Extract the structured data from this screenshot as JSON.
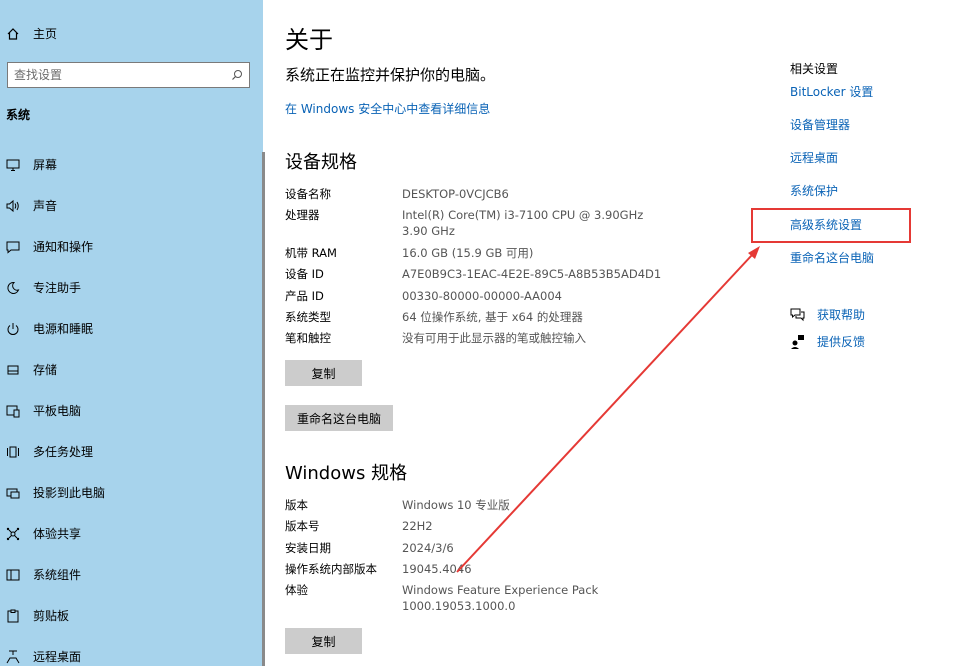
{
  "sidebar": {
    "home_label": "主页",
    "search_placeholder": "查找设置",
    "section_title": "系统",
    "items": [
      {
        "label": "屏幕"
      },
      {
        "label": "声音"
      },
      {
        "label": "通知和操作"
      },
      {
        "label": "专注助手"
      },
      {
        "label": "电源和睡眠"
      },
      {
        "label": "存储"
      },
      {
        "label": "平板电脑"
      },
      {
        "label": "多任务处理"
      },
      {
        "label": "投影到此电脑"
      },
      {
        "label": "体验共享"
      },
      {
        "label": "系统组件"
      },
      {
        "label": "剪贴板"
      },
      {
        "label": "远程桌面"
      }
    ]
  },
  "main": {
    "title": "关于",
    "status": "系统正在监控并保护你的电脑。",
    "security_link": "在 Windows 安全中心中查看详细信息",
    "device_spec_title": "设备规格",
    "device_specs": [
      {
        "label": "设备名称",
        "value": "DESKTOP-0VCJCB6"
      },
      {
        "label": "处理器",
        "value": "Intel(R) Core(TM) i3-7100 CPU @ 3.90GHz   3.90 GHz"
      },
      {
        "label": "机带 RAM",
        "value": "16.0 GB (15.9 GB 可用)"
      },
      {
        "label": "设备 ID",
        "value": "A7E0B9C3-1EAC-4E2E-89C5-A8B53B5AD4D1"
      },
      {
        "label": "产品 ID",
        "value": "00330-80000-00000-AA004"
      },
      {
        "label": "系统类型",
        "value": "64 位操作系统, 基于 x64 的处理器"
      },
      {
        "label": "笔和触控",
        "value": "没有可用于此显示器的笔或触控输入"
      }
    ],
    "copy_button": "复制",
    "rename_button": "重命名这台电脑",
    "windows_spec_title": "Windows 规格",
    "windows_specs": [
      {
        "label": "版本",
        "value": "Windows 10 专业版"
      },
      {
        "label": "版本号",
        "value": "22H2"
      },
      {
        "label": "安装日期",
        "value": "2024/3/6"
      },
      {
        "label": "操作系统内部版本",
        "value": "19045.4046"
      },
      {
        "label": "体验",
        "value": "Windows Feature Experience Pack 1000.19053.1000.0"
      }
    ],
    "copy_button_2": "复制"
  },
  "related": {
    "title": "相关设置",
    "links": [
      {
        "label": "BitLocker 设置"
      },
      {
        "label": "设备管理器"
      },
      {
        "label": "远程桌面"
      },
      {
        "label": "系统保护"
      },
      {
        "label": "高级系统设置"
      },
      {
        "label": "重命名这台电脑"
      }
    ],
    "get_help": "获取帮助",
    "feedback": "提供反馈"
  },
  "colors": {
    "sidebar_bg": "#a7d3ec",
    "link": "#0a63b6",
    "highlight": "#e53935"
  }
}
